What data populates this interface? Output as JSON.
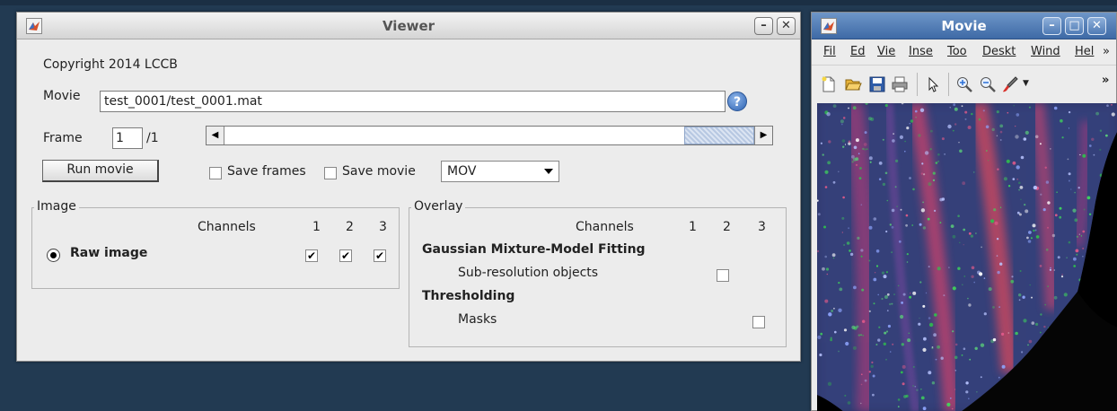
{
  "viewer": {
    "title": "Viewer",
    "copyright": "Copyright 2014 LCCB",
    "movie_label": "Movie",
    "movie_path": "test_0001/test_0001.mat",
    "help_glyph": "?",
    "frame_label": "Frame",
    "frame_value": "1",
    "frame_total": "/1",
    "frame_slider_position": 1,
    "run_button": "Run movie",
    "save_frames_label": "Save frames",
    "save_frames_checked": false,
    "save_movie_label": "Save movie",
    "save_movie_checked": false,
    "format_value": "MOV",
    "image_panel": {
      "title": "Image",
      "channels_label": "Channels",
      "channel_numbers": [
        "1",
        "2",
        "3"
      ],
      "raw_image_label": "Raw image",
      "raw_image_selected": true,
      "channel_checks": [
        true,
        true,
        true
      ]
    },
    "overlay_panel": {
      "title": "Overlay",
      "channels_label": "Channels",
      "channel_numbers": [
        "1",
        "2",
        "3"
      ],
      "groups": [
        {
          "title": "Gaussian Mixture-Model Fitting",
          "item": "Sub-resolution objects",
          "checked": false
        },
        {
          "title": "Thresholding",
          "item": "Masks",
          "checked": false
        }
      ]
    },
    "window_buttons": [
      "minimize-icon",
      "close-icon"
    ]
  },
  "movie": {
    "title": "Movie",
    "menu": [
      "Fil",
      "Ed",
      "Vie",
      "Inse",
      "Too",
      "Deskt",
      "Wind",
      "Hel"
    ],
    "menu_overflow": "»",
    "toolbar_overflow": "»",
    "toolbar": [
      "new-file-icon",
      "open-folder-icon",
      "save-icon",
      "print-icon",
      "pointer-icon",
      "zoom-in-icon",
      "zoom-out-icon",
      "brush-icon"
    ],
    "window_buttons": [
      "minimize-icon",
      "maximize-icon",
      "close-icon"
    ]
  },
  "colors": {
    "desktop": "#223a52",
    "window_bg": "#ececec",
    "movie_title_bar": "#4a76b0",
    "help_blue": "#2c62b2"
  }
}
